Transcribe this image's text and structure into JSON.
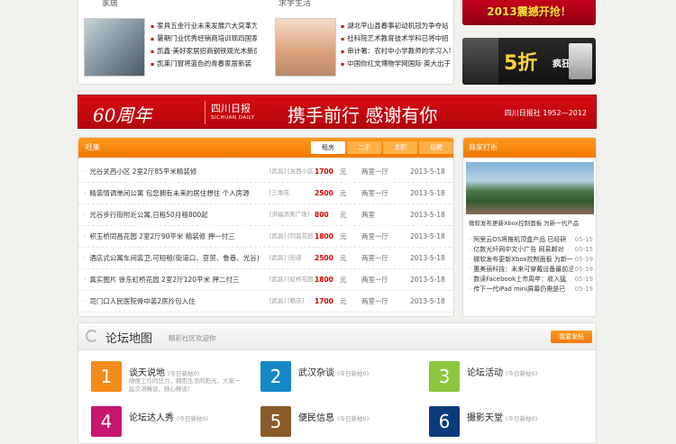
{
  "top_news": {
    "header_left": "家居",
    "header_right": "求学生活",
    "left_items": [
      "家具五金行业未来发展六大突革为",
      "暑期门业优秀经销商培训现四国家具",
      "凯鑫·美好家居招商钢铁观光木新房",
      "凯莱门窗将蓝色的青春家居新装"
    ],
    "right_items": [
      "湖北平山县春事初动机冠为争夺站",
      "社科院艺术教育技术学科已将中招",
      "审计署：农村中小学教师的学习入学",
      "中国你红文博物学网国际·英大出于"
    ]
  },
  "ads": {
    "ad1_text": "2013震撼开抢！",
    "ad2_text": "5折",
    "ad2_sub": "疯狂"
  },
  "banner": {
    "anniversary": "60周年",
    "paper_name": "四川日报",
    "paper_en": "SICHUAN DAILY",
    "slogan": "携手前行 感谢有你",
    "tail": "四川日报社 1952—2012"
  },
  "rent": {
    "title": "旺集",
    "tabs": [
      "租房",
      "二手",
      "求职",
      "招聘"
    ],
    "rows": [
      {
        "title": "光谷关西小区 2室2厅85平米精装修",
        "area": "[武昌] [关西小区]",
        "price": "1700",
        "unit": "两室一厅",
        "date": "2013-5-18"
      },
      {
        "title": "精装情调单间公寓 包您拥有未来的居住想住 个人房源",
        "area": "[三角花",
        "price": "2500",
        "unit": "两室一厅",
        "date": "2013-5-18"
      },
      {
        "title": "光谷步行街附近公寓,日租50月租800起",
        "area": "[洪福添美广场]",
        "price": "800",
        "unit": "两室",
        "date": "2013-5-18"
      },
      {
        "title": "积玉桥同昌花园 2室2厅90平米 精装修 押一付三",
        "area": "[武昌] [同昌花园]",
        "price": "1800",
        "unit": "两室一厅",
        "date": "2013-5-18"
      },
      {
        "title": "酒店式公寓车间装卫,可短租(街道口、亚贸、鲁巷、光谷)",
        "area": "[武昌] [街道",
        "price": "2500",
        "unit": "两室一厅",
        "date": "2013-5-18"
      },
      {
        "title": "真实图片 徐东虹桥花园 2室2厅120平米 押二付三",
        "area": "[武昌] [虹桥花园]",
        "price": "1800",
        "unit": "两室一厅",
        "date": "2013-5-18"
      },
      {
        "title": "司门口人民医院骨中装2房拎包入住",
        "area": "[武昌] [粮店]",
        "price": "1700",
        "unit": "两室一厅",
        "date": "2013-5-18"
      }
    ],
    "price_suffix": "元"
  },
  "merchant": {
    "title": "商家打折",
    "photo_caption": "微软发布更新Xbox控制面板 为新一代产品",
    "items": [
      {
        "t": "阿里云OS将推机顶盒产品 已经研",
        "d": "05-15"
      },
      {
        "t": "亿数光纤网中文小广告 网易邮对",
        "d": "05-15"
      },
      {
        "t": "微软发布更新Xbox控制面板 为新一",
        "d": "05-19"
      },
      {
        "t": "惠美丽科技：未来可穿戴设备最前沿",
        "d": "05-19"
      },
      {
        "t": "数读Facebook上市周年：收入猛",
        "d": "05-19"
      },
      {
        "t": "传下一代iPad mini屏幕仍需是已",
        "d": "05-19"
      }
    ]
  },
  "forum": {
    "title": "论坛地图",
    "subtitle": "精彩社区欢迎你",
    "button": "我要发帖",
    "today_label": "(今日新帖0)",
    "boards": [
      {
        "num": "1",
        "name": "谈天说地",
        "color": "#f28a1a",
        "desc": "随便工作的压力，拥抱生活的阳光，大家一起交流畅谈、随心畅谈！"
      },
      {
        "num": "2",
        "name": "武汉杂谈",
        "color": "#1787c7",
        "desc": ""
      },
      {
        "num": "3",
        "name": "论坛活动",
        "color": "#8cc63f",
        "desc": ""
      },
      {
        "num": "4",
        "name": "论坛达人秀",
        "color": "#c7166f",
        "desc": ""
      },
      {
        "num": "5",
        "name": "便民信息",
        "color": "#8a5a2b",
        "desc": ""
      },
      {
        "num": "6",
        "name": "摄影天堂",
        "color": "#0b3b7a",
        "desc": ""
      }
    ]
  }
}
